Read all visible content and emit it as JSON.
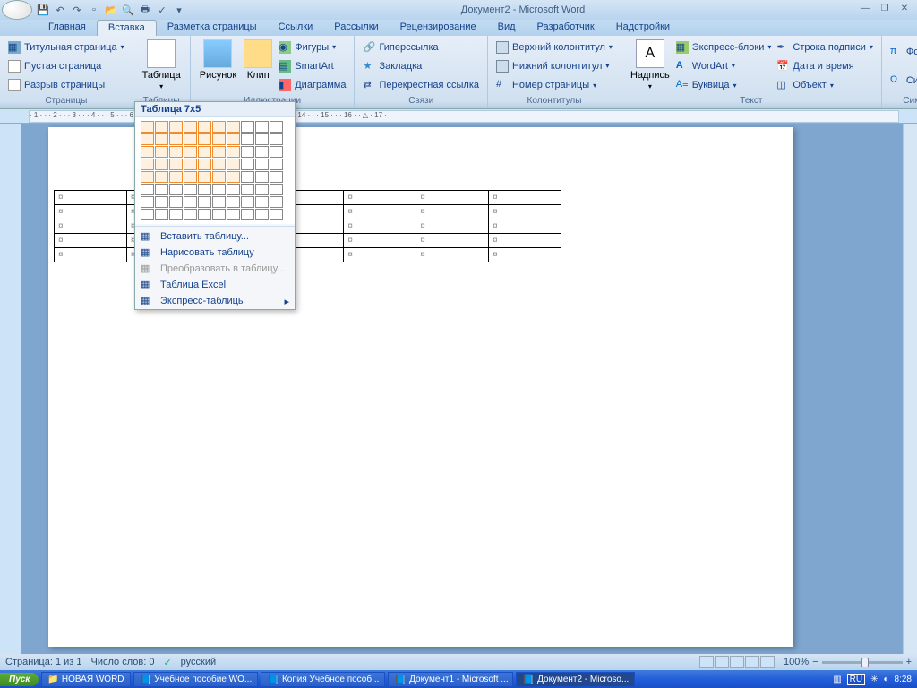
{
  "title": "Документ2 - Microsoft Word",
  "tabs": [
    "Главная",
    "Вставка",
    "Разметка страницы",
    "Ссылки",
    "Рассылки",
    "Рецензирование",
    "Вид",
    "Разработчик",
    "Надстройки"
  ],
  "active_tab": 1,
  "groups": {
    "pages": {
      "title": "Страницы",
      "items": [
        "Титульная страница",
        "Пустая страница",
        "Разрыв страницы"
      ]
    },
    "tables": {
      "title": "Таблицы",
      "btn": "Таблица"
    },
    "illus": {
      "title": "Иллюстрации",
      "pic": "Рисунок",
      "clip": "Клип",
      "col": [
        "Фигуры",
        "SmartArt",
        "Диаграмма"
      ]
    },
    "links": {
      "title": "Связи",
      "col": [
        "Гиперссылка",
        "Закладка",
        "Перекрестная ссылка"
      ]
    },
    "headfoot": {
      "title": "Колонтитулы",
      "col": [
        "Верхний колонтитул",
        "Нижний колонтитул",
        "Номер страницы"
      ]
    },
    "text": {
      "title": "Текст",
      "box": "Надпись",
      "col1": [
        "Экспресс-блоки",
        "WordArt",
        "Буквица"
      ],
      "col2": [
        "Строка подписи",
        "Дата и время",
        "Объект"
      ]
    },
    "symbols": {
      "title": "Символы",
      "col": [
        "Формула",
        "Символ"
      ]
    }
  },
  "table_popup": {
    "title": "Таблица 7x5",
    "sel_cols": 7,
    "sel_rows": 5,
    "items": [
      {
        "label": "Вставить таблицу...",
        "disabled": false
      },
      {
        "label": "Нарисовать таблицу",
        "disabled": false
      },
      {
        "label": "Преобразовать в таблицу...",
        "disabled": true
      },
      {
        "label": "Таблица Excel",
        "disabled": false
      },
      {
        "label": "Экспресс-таблицы",
        "disabled": false,
        "sub": true
      }
    ]
  },
  "preview_cols_total": 7,
  "status": {
    "page": "Страница: 1 из 1",
    "words": "Число слов: 0",
    "lang": "русский",
    "zoom": "100%"
  },
  "taskbar": {
    "start": "Пуск",
    "items": [
      {
        "label": "НОВАЯ WORD",
        "active": false,
        "type": "folder"
      },
      {
        "label": "Учебное пособие WO...",
        "active": false,
        "type": "word"
      },
      {
        "label": "Копия Учебное пособ...",
        "active": false,
        "type": "word"
      },
      {
        "label": "Документ1 - Microsoft ...",
        "active": false,
        "type": "word"
      },
      {
        "label": "Документ2 - Microso...",
        "active": true,
        "type": "word"
      }
    ],
    "lang_ind": "RU",
    "clock": "8:28"
  }
}
